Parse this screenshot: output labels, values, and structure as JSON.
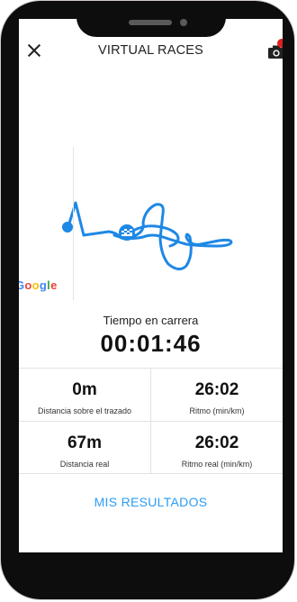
{
  "header": {
    "title": "VIRTUAL RACES",
    "close_icon": "close-icon",
    "camera_icon": "camera-icon"
  },
  "map": {
    "attribution": "Google",
    "route_color": "#1e88e5",
    "marker_icon": "finish-flag-icon"
  },
  "timer": {
    "label": "Tiempo en carrera",
    "value": "00:01:46"
  },
  "stats": [
    {
      "value": "0m",
      "label": "Distancia sobre el trazado"
    },
    {
      "value": "26:02",
      "label": "Ritmo (min/km)"
    },
    {
      "value": "67m",
      "label": "Distancia real"
    },
    {
      "value": "26:02",
      "label": "Ritmo real (min/km)"
    }
  ],
  "actions": {
    "results_label": "MIS RESULTADOS"
  },
  "colors": {
    "accent": "#2a9df4",
    "record": "#e02020"
  }
}
